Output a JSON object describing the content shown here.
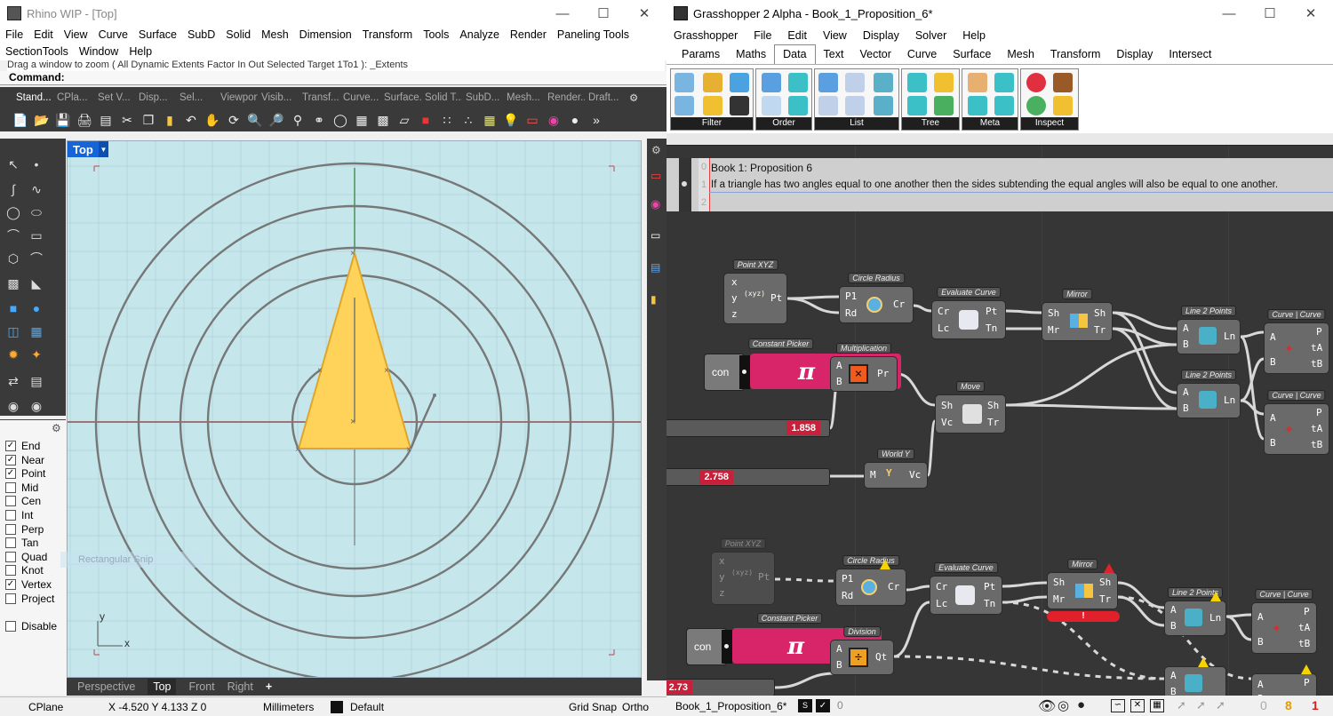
{
  "rhino": {
    "title": "Rhino WIP - [Top]",
    "menu": [
      "File",
      "Edit",
      "View",
      "Curve",
      "Surface",
      "SubD",
      "Solid",
      "Mesh",
      "Dimension",
      "Transform",
      "Tools",
      "Analyze",
      "Render",
      "Paneling Tools",
      "SectionTools",
      "Window",
      "Help"
    ],
    "command_history": "Drag a window to zoom ( All  Dynamic  Extents  Factor  In  Out  Selected  Target  1To1 ): _Extents",
    "command_label": "Command:",
    "toolbar_tabs": [
      "Stand...",
      "CPla...",
      "Set V...",
      "Disp...",
      "Sel...",
      "Viewport...",
      "Visib...",
      "Transf...",
      "Curve...",
      "Surface...",
      "Solid T...",
      "SubD...",
      "Mesh...",
      "Render...",
      "Draft..."
    ],
    "viewport_name": "Top",
    "osnaps": [
      {
        "label": "End",
        "checked": true
      },
      {
        "label": "Near",
        "checked": true
      },
      {
        "label": "Point",
        "checked": true
      },
      {
        "label": "Mid",
        "checked": false
      },
      {
        "label": "Cen",
        "checked": false
      },
      {
        "label": "Int",
        "checked": false
      },
      {
        "label": "Perp",
        "checked": false
      },
      {
        "label": "Tan",
        "checked": false
      },
      {
        "label": "Quad",
        "checked": false
      },
      {
        "label": "Knot",
        "checked": false
      },
      {
        "label": "Vertex",
        "checked": true
      },
      {
        "label": "Project",
        "checked": false
      }
    ],
    "disable_label": "Disable",
    "ghost_text": "Rectangular Snip",
    "axis_x": "x",
    "axis_y": "y",
    "viewport_tabs": [
      "Perspective",
      "Top",
      "Front",
      "Right"
    ],
    "active_viewport_tab": "Top",
    "add_tab": "+",
    "status": {
      "cplane": "CPlane",
      "coords": "X -4.520  Y 4.133  Z 0",
      "units": "Millimeters",
      "layer": "Default",
      "grid_snap": "Grid Snap",
      "ortho": "Ortho"
    },
    "colors": {
      "viewport_bg": "#c5e7ec",
      "triangle_fill": "#ffd25a",
      "curve": "#777777",
      "x_axis": "#8b3030",
      "y_axis": "#2f7a2f"
    }
  },
  "grasshopper": {
    "title": "Grasshopper 2 Alpha - Book_1_Proposition_6*",
    "menu": [
      "Grasshopper",
      "File",
      "Edit",
      "View",
      "Display",
      "Solver",
      "Help"
    ],
    "tabs": [
      "Params",
      "Maths",
      "Data",
      "Text",
      "Vector",
      "Curve",
      "Surface",
      "Mesh",
      "Transform",
      "Display",
      "Intersect"
    ],
    "active_tab": "Data",
    "ribbon_groups": [
      "Filter",
      "Order",
      "List",
      "Tree",
      "Meta",
      "Inspect"
    ],
    "scribble": {
      "line_numbers": [
        "0",
        "1",
        "2"
      ],
      "title": "Book 1: Proposition 6",
      "text": "If a triangle has two angles equal to one another then the sides subtending the equal angles will also be equal to one another."
    },
    "components": {
      "point_xyz": {
        "title": "Point XYZ",
        "inputs": [
          "x",
          "y",
          "z"
        ],
        "outputs": [
          "Pt"
        ],
        "icon_text": "(xyz)"
      },
      "circle_radius": {
        "title": "Circle Radius",
        "inputs": [
          "P1",
          "Rd"
        ],
        "outputs": [
          "Cr"
        ]
      },
      "evaluate_curve": {
        "title": "Evaluate Curve",
        "inputs": [
          "Cr",
          "Lc"
        ],
        "outputs": [
          "Pt",
          "Tn"
        ]
      },
      "mirror": {
        "title": "Mirror",
        "inputs": [
          "Sh",
          "Mr"
        ],
        "outputs": [
          "Sh",
          "Tr"
        ]
      },
      "line_2_points_a": {
        "title": "Line 2 Points",
        "inputs": [
          "A",
          "B"
        ],
        "outputs": [
          "Ln"
        ]
      },
      "line_2_points_b": {
        "title": "Line 2 Points",
        "inputs": [
          "A",
          "B"
        ],
        "outputs": [
          "Ln"
        ]
      },
      "curve_curve_a": {
        "title": "Curve | Curve",
        "inputs": [
          "A",
          "B"
        ],
        "outputs": [
          "P",
          "tA",
          "tB"
        ]
      },
      "curve_curve_b": {
        "title": "Curve | Curve",
        "inputs": [
          "A",
          "B"
        ],
        "outputs": [
          "P",
          "tA",
          "tB"
        ]
      },
      "constant_picker": {
        "title": "Constant Picker",
        "label": "con",
        "symbol": "π"
      },
      "multiplication": {
        "title": "Multiplication",
        "inputs": [
          "A",
          "B"
        ],
        "outputs": [
          "Pr"
        ],
        "icon_text": "×"
      },
      "move": {
        "title": "Move",
        "inputs": [
          "Sh",
          "Vc"
        ],
        "outputs": [
          "Sh",
          "Tr"
        ]
      },
      "world_y": {
        "title": "World Y",
        "inputs": [
          "M"
        ],
        "outputs": [
          "Vc"
        ],
        "icon_text": "Y"
      },
      "point_xyz_2": {
        "title": "Point XYZ",
        "inputs": [
          "x",
          "y",
          "z"
        ],
        "outputs": [
          "Pt"
        ],
        "icon_text": "(xyz)"
      },
      "circle_radius_2": {
        "title": "Circle Radius",
        "inputs": [
          "P1",
          "Rd"
        ],
        "outputs": [
          "Cr"
        ]
      },
      "evaluate_curve_2": {
        "title": "Evaluate Curve",
        "inputs": [
          "Cr",
          "Lc"
        ],
        "outputs": [
          "Pt",
          "Tn"
        ]
      },
      "mirror_2": {
        "title": "Mirror",
        "inputs": [
          "Sh",
          "Mr"
        ],
        "outputs": [
          "Sh",
          "Tr"
        ],
        "error_text": "!"
      },
      "line_2_points_c": {
        "title": "Line 2 Points",
        "inputs": [
          "A",
          "B"
        ],
        "outputs": [
          "Ln"
        ]
      },
      "curve_curve_c": {
        "title": "Curve | Curve",
        "inputs": [
          "A",
          "B"
        ],
        "outputs": [
          "P",
          "tA",
          "tB"
        ]
      },
      "constant_picker_2": {
        "title": "Constant Picker",
        "label": "con",
        "symbol": "π"
      },
      "division": {
        "title": "Division",
        "inputs": [
          "A",
          "B"
        ],
        "outputs": [
          "Qt"
        ],
        "icon_text": "÷"
      },
      "line_2_points_d": {
        "inputs": [
          "A",
          "B"
        ]
      },
      "curve_curve_d": {
        "inputs": [
          "A",
          "B"
        ],
        "outputs": [
          "P"
        ]
      }
    },
    "sliders": {
      "s1": "1.858",
      "s2": "2.758",
      "s3": "2.73"
    },
    "status": {
      "file": "Book_1_Proposition_6*",
      "zero": "0",
      "count_grey": "0",
      "count_warn": "8",
      "count_err": "1"
    },
    "colors": {
      "canvas": "#363636",
      "component": "#6a6a6a",
      "slider_value": "#c8203a",
      "constant": "#d8256a",
      "warning": "#f7d400",
      "error": "#e0202a"
    }
  }
}
